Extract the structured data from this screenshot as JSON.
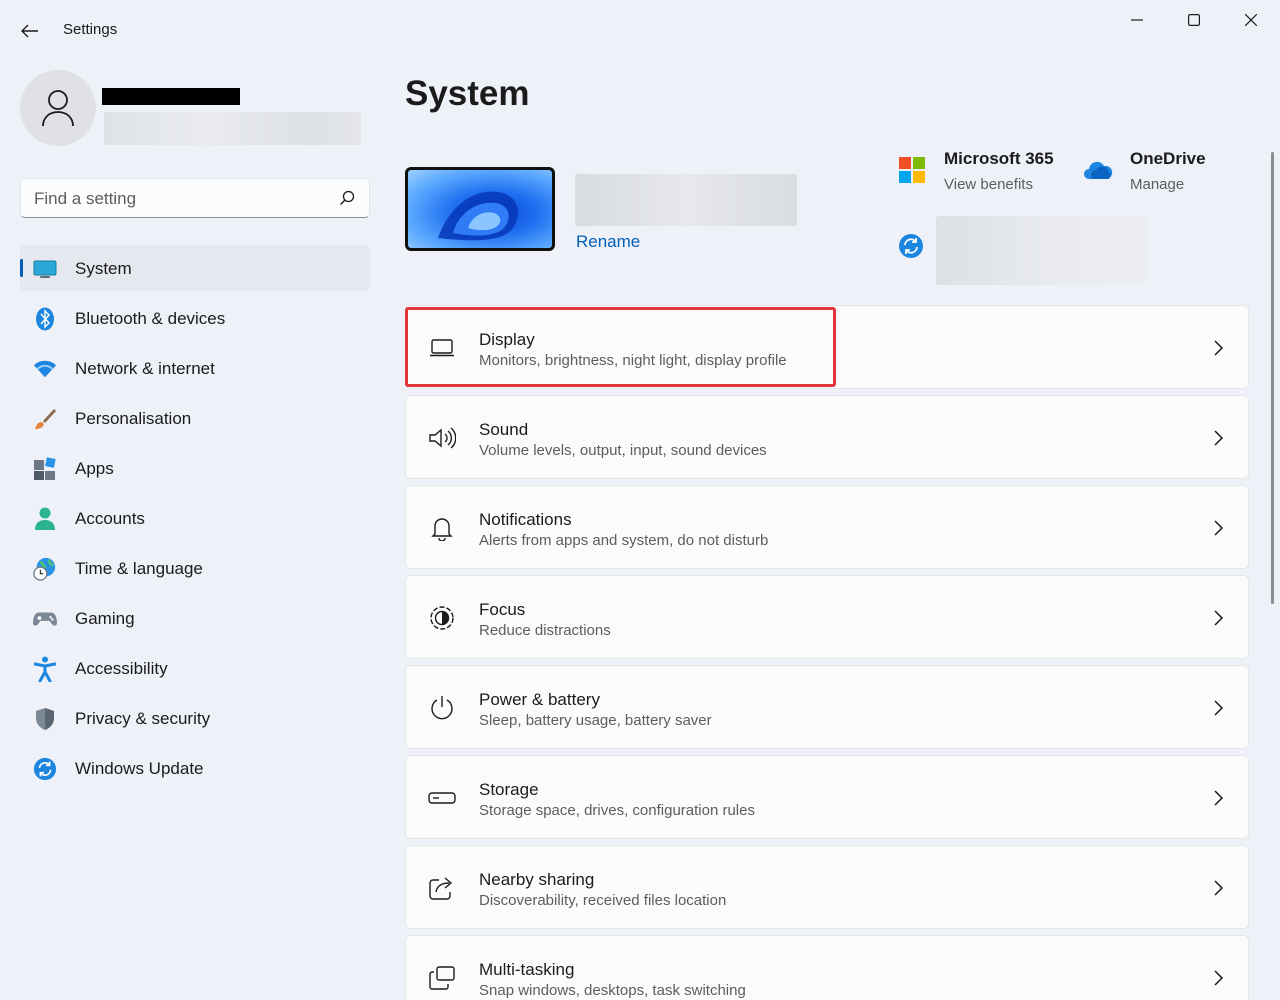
{
  "window": {
    "title": "Settings",
    "back_icon": "back-arrow-icon",
    "controls": [
      "minimize-icon",
      "maximize-icon",
      "close-icon"
    ]
  },
  "search": {
    "placeholder": "Find a setting",
    "icon": "search-icon"
  },
  "sidebar": {
    "items": [
      {
        "label": "System",
        "icon": "system-icon",
        "active": true
      },
      {
        "label": "Bluetooth & devices",
        "icon": "bluetooth-icon"
      },
      {
        "label": "Network & internet",
        "icon": "wifi-icon"
      },
      {
        "label": "Personalisation",
        "icon": "brush-icon"
      },
      {
        "label": "Apps",
        "icon": "apps-icon"
      },
      {
        "label": "Accounts",
        "icon": "person-icon"
      },
      {
        "label": "Time & language",
        "icon": "globe-clock-icon"
      },
      {
        "label": "Gaming",
        "icon": "gamepad-icon"
      },
      {
        "label": "Accessibility",
        "icon": "accessibility-icon"
      },
      {
        "label": "Privacy & security",
        "icon": "shield-icon"
      },
      {
        "label": "Windows Update",
        "icon": "update-icon"
      }
    ]
  },
  "main": {
    "title": "System",
    "device": {
      "rename_label": "Rename"
    },
    "microsoft365": {
      "title": "Microsoft 365",
      "subtitle": "View benefits"
    },
    "onedrive": {
      "title": "OneDrive",
      "subtitle": "Manage"
    },
    "cards": [
      {
        "title": "Display",
        "subtitle": "Monitors, brightness, night light, display profile",
        "icon": "laptop-icon",
        "highlighted": true
      },
      {
        "title": "Sound",
        "subtitle": "Volume levels, output, input, sound devices",
        "icon": "speaker-icon"
      },
      {
        "title": "Notifications",
        "subtitle": "Alerts from apps and system, do not disturb",
        "icon": "bell-icon"
      },
      {
        "title": "Focus",
        "subtitle": "Reduce distractions",
        "icon": "focus-icon"
      },
      {
        "title": "Power & battery",
        "subtitle": "Sleep, battery usage, battery saver",
        "icon": "power-icon"
      },
      {
        "title": "Storage",
        "subtitle": "Storage space, drives, configuration rules",
        "icon": "storage-icon"
      },
      {
        "title": "Nearby sharing",
        "subtitle": "Discoverability, received files location",
        "icon": "share-icon"
      },
      {
        "title": "Multi-tasking",
        "subtitle": "Snap windows, desktops, task switching",
        "icon": "multitask-icon"
      }
    ]
  },
  "colors": {
    "accent": "#005fb8",
    "highlight": "#e0383c",
    "background": "#eef2f8"
  }
}
